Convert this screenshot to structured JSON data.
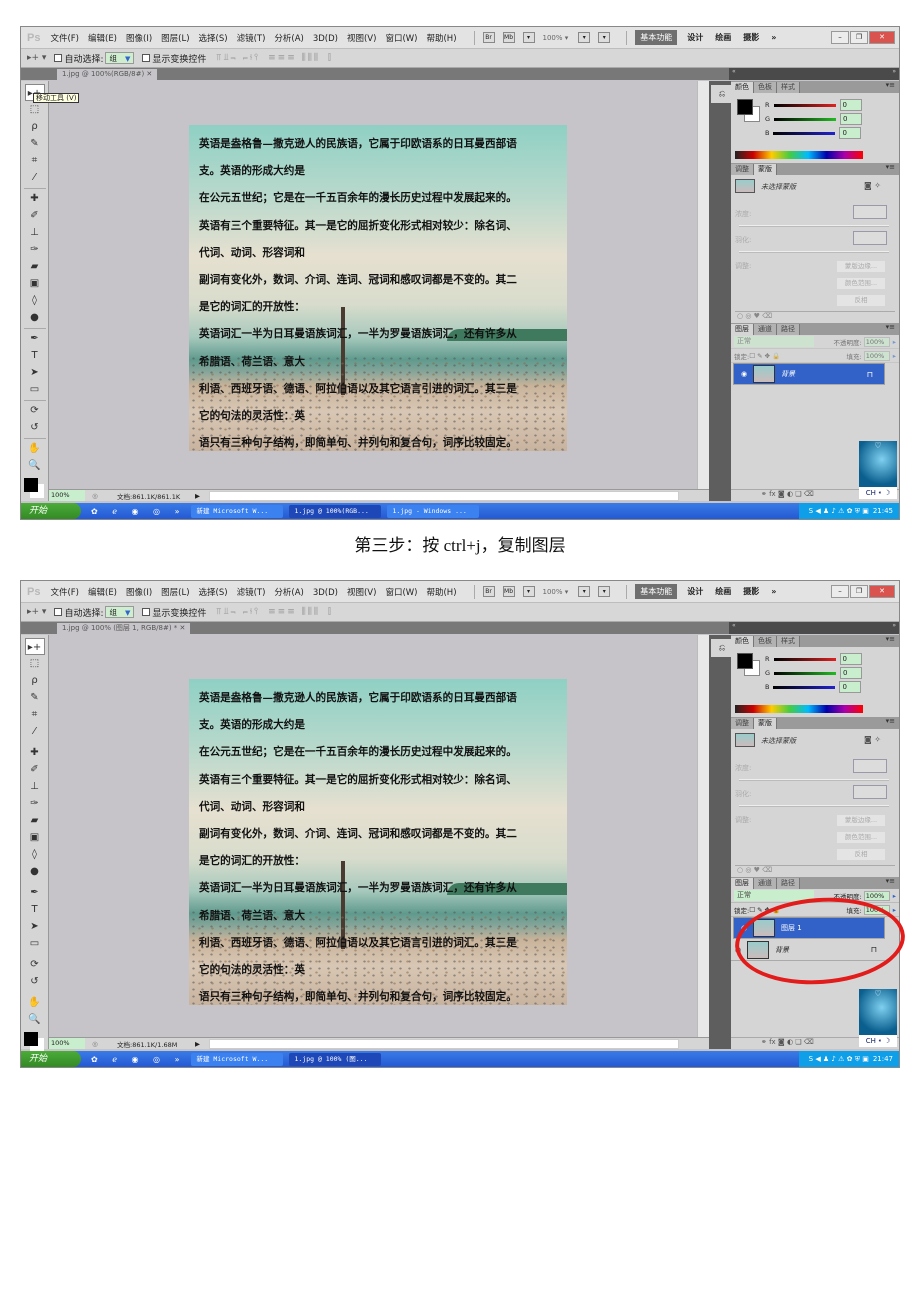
{
  "app": {
    "logo": "Ps",
    "menu": [
      "文件(F)",
      "编辑(E)",
      "图像(I)",
      "图层(L)",
      "选择(S)",
      "滤镜(T)",
      "分析(A)",
      "3D(D)",
      "视图(V)",
      "窗口(W)",
      "帮助(H)"
    ],
    "mini_buttons": [
      "Br",
      "Mb"
    ],
    "zoom_select": "100% ▾",
    "workspaces": {
      "active": "基本功能",
      "others": [
        "设计",
        "绘画",
        "摄影",
        "»"
      ]
    },
    "window_buttons": [
      "–",
      "❐",
      "✕"
    ],
    "options": {
      "auto_select_label": "自动选择:",
      "auto_select_value": "组",
      "show_transform_label": "显示变换控件",
      "align_icons": "⫪⫫⫬ ⫭⫮⫯",
      "distribute_icons": "≡≡≡ ⫼⫼⫼",
      "auto_align_icon": "⫿"
    }
  },
  "toolbox": {
    "tools": [
      {
        "name": "move-tool",
        "glyph": "▸+"
      },
      {
        "name": "marquee-tool",
        "glyph": "⬚"
      },
      {
        "name": "lasso-tool",
        "glyph": "ρ"
      },
      {
        "name": "quick-select-tool",
        "glyph": "✎"
      },
      {
        "name": "crop-tool",
        "glyph": "⌗"
      },
      {
        "name": "eyedropper-tool",
        "glyph": "⁄"
      },
      {
        "name": "healing-tool",
        "glyph": "✚"
      },
      {
        "name": "brush-tool",
        "glyph": "✐"
      },
      {
        "name": "stamp-tool",
        "glyph": "⊥"
      },
      {
        "name": "history-brush-tool",
        "glyph": "✑"
      },
      {
        "name": "eraser-tool",
        "glyph": "▰"
      },
      {
        "name": "gradient-tool",
        "glyph": "▣"
      },
      {
        "name": "blur-tool",
        "glyph": "◊"
      },
      {
        "name": "dodge-tool",
        "glyph": "●"
      },
      {
        "name": "pen-tool",
        "glyph": "✒"
      },
      {
        "name": "type-tool",
        "glyph": "T"
      },
      {
        "name": "path-select-tool",
        "glyph": "➤"
      },
      {
        "name": "shape-tool",
        "glyph": "▭"
      },
      {
        "name": "3d-rotate-tool",
        "glyph": "⟳"
      },
      {
        "name": "3d-orbit-tool",
        "glyph": "↺"
      },
      {
        "name": "hand-tool",
        "glyph": "✋"
      },
      {
        "name": "zoom-tool",
        "glyph": "🔍"
      }
    ],
    "tooltip": "移动工具 (V)"
  },
  "canvas_text": [
    "英语是盎格鲁—撒克逊人的民族语，它属于印欧语系的日耳曼西部语",
    "支。英语的形成大约是",
    "在公元五世纪；它是在一千五百余年的漫长历史过程中发展起来的。",
    "英语有三个重要特征。其一是它的屈折变化形式相对较少：除名词、",
    "代词、动词、形容词和",
    "副词有变化外，数词、介词、连词、冠词和感叹词都是不变的。其二",
    "是它的词汇的开放性：",
    "英语词汇一半为日耳曼语族词汇，一半为罗曼语族词汇，还有许多从",
    "希腊语、荷兰语、意大",
    "利语、西班牙语、德语、阿拉伯语以及其它语言引进的词汇。其三是",
    "它的句法的灵活性：英",
    "语只有三种句子结构，即简单句、并列句和复合句，词序比较固定。"
  ],
  "panels": {
    "color_tabs": [
      "颜色",
      "色板",
      "样式"
    ],
    "rgb": [
      {
        "label": "R",
        "value": "0",
        "color": "#d22"
      },
      {
        "label": "G",
        "value": "0",
        "color": "#2b2"
      },
      {
        "label": "B",
        "value": "0",
        "color": "#22c"
      }
    ],
    "adj_tabs": [
      "调整",
      "蒙版"
    ],
    "mask": {
      "label": "未选择蒙版",
      "density_label": "浓度:",
      "feather_label": "羽化:",
      "refine_label": "调整:",
      "buttons": [
        "蒙版边缘...",
        "颜色范围...",
        "反相"
      ]
    },
    "layers_tabs": [
      "图层",
      "通道",
      "路径"
    ],
    "blend_mode": "正常",
    "opacity_label": "不透明度:",
    "opacity_value": "100%",
    "lock_label": "锁定:",
    "fill_label": "填充:",
    "fill_value": "100%",
    "footer_icons": "⚭ fx ◙ ◐ ❑ ⌫"
  },
  "screens": [
    {
      "doc_tab": "1.jpg @ 100%(RGB/8#) ✕",
      "layers": [
        {
          "name": "背景",
          "locked": true,
          "selected": true
        }
      ],
      "status_zoom": "100%",
      "status_doc": "文档:861.1K/861.1K",
      "taskbar": {
        "start": "开始",
        "tasks": [
          "新建 Microsoft W...",
          "1.jpg @ 100%(RGB...",
          "1.jpg - Windows ..."
        ],
        "active_task": 1,
        "clock": "21:45"
      },
      "layers_enabled": false,
      "show_tooltip": true
    },
    {
      "doc_tab": "1.jpg @ 100% (图层 1, RGB/8#) * ✕",
      "layers": [
        {
          "name": "图层 1",
          "locked": false,
          "selected": true
        },
        {
          "name": "背景",
          "locked": true,
          "selected": false
        }
      ],
      "status_zoom": "100%",
      "status_doc": "文档:861.1K/1.68M",
      "taskbar": {
        "start": "开始",
        "tasks": [
          "新建 Microsoft W...",
          "1.jpg @ 100% (图..."
        ],
        "active_task": 1,
        "clock": "21:47"
      },
      "layers_enabled": true,
      "show_tooltip": false
    }
  ],
  "caption": "第三步：按 ctrl+j，复制图层",
  "widget": {
    "ime": "CH ⁌ ☽"
  },
  "colors": {
    "highlight_ring": "#e21b1b",
    "layer_selected": "#3262c8",
    "input_bg": "#c9eecd"
  }
}
